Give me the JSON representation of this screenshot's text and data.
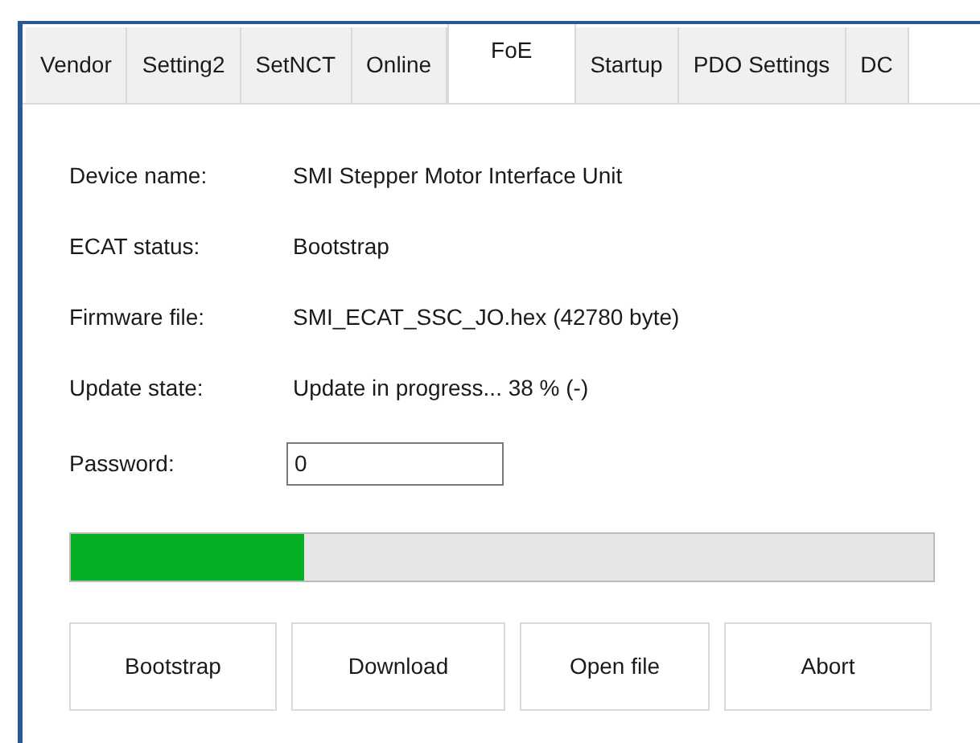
{
  "tabs": [
    {
      "label": "Vendor",
      "selected": false
    },
    {
      "label": "Setting2",
      "selected": false
    },
    {
      "label": "SetNCT",
      "selected": false
    },
    {
      "label": "Online",
      "selected": false
    },
    {
      "label": "FoE",
      "selected": true
    },
    {
      "label": "Startup",
      "selected": false
    },
    {
      "label": "PDO Settings",
      "selected": false
    },
    {
      "label": "DC",
      "selected": false
    }
  ],
  "fields": [
    {
      "label": "Device name:",
      "value": "SMI Stepper Motor Interface Unit"
    },
    {
      "label": "ECAT status:",
      "value": "Bootstrap"
    },
    {
      "label": "Firmware file:",
      "value": "SMI_ECAT_SSC_JO.hex (42780 byte)"
    },
    {
      "label": "Update state:",
      "value": "Update in progress... 38 % (-)"
    }
  ],
  "password": {
    "label": "Password:",
    "value": "0"
  },
  "progress": {
    "level": 0.27
  },
  "buttons": [
    "Bootstrap",
    "Download",
    "Open file",
    "Abort"
  ]
}
